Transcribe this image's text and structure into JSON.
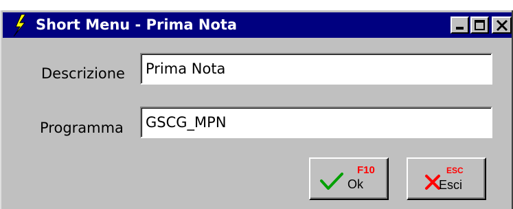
{
  "window": {
    "title": "Short Menu - Prima Nota",
    "title_icon": "lightning-bolt-icon",
    "controls": [
      "minimize",
      "maximize",
      "close"
    ]
  },
  "form": {
    "descrizione_label": "Descrizione",
    "descrizione_value": "Prima Nota",
    "programma_label": "Programma",
    "programma_value": "GSCG_MPN"
  },
  "buttons": {
    "ok": {
      "key": "F10",
      "label": "Ok",
      "icon": "checkmark-icon"
    },
    "esci": {
      "key": "ESC",
      "label": "Esci",
      "icon": "x-mark-icon"
    }
  },
  "colors": {
    "titlebar": "#000080",
    "face": "#c0c0c0",
    "hotkey": "#ff0000",
    "check": "#00a000",
    "cross": "#ff0000"
  }
}
